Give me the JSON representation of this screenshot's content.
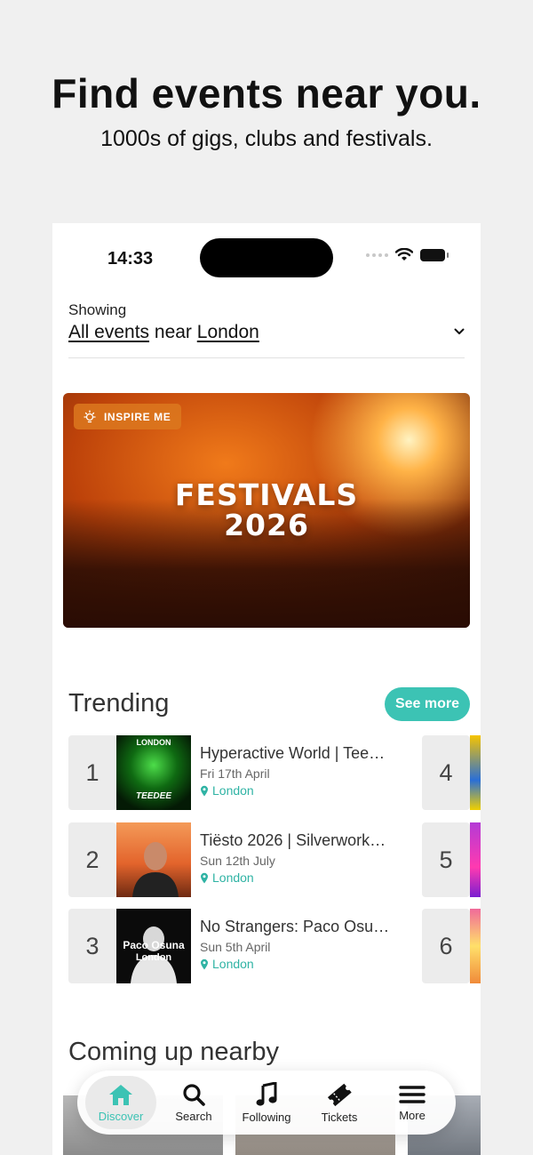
{
  "hero": {
    "title": "Find events near you.",
    "subtitle": "1000s of gigs, clubs and festivals."
  },
  "status_bar": {
    "time": "14:33"
  },
  "location_picker": {
    "showing_label": "Showing",
    "filter": "All events",
    "connector": "near",
    "city": "London"
  },
  "banner": {
    "badge": "INSPIRE ME",
    "title_line1": "FESTIVALS",
    "title_line2": "2026"
  },
  "trending": {
    "title": "Trending",
    "see_more": "See more",
    "items": [
      {
        "rank": "1",
        "title": "Hyperactive World | Tee…",
        "date": "Fri 17th April",
        "city": "London",
        "thumb_top": "LONDON",
        "thumb_bottom": "TEEDEE"
      },
      {
        "rank": "2",
        "title": "Tiësto 2026 | Silverwork…",
        "date": "Sun 12th July",
        "city": "London"
      },
      {
        "rank": "3",
        "title": "No Strangers: Paco Osu…",
        "date": "Sun 5th April",
        "city": "London",
        "thumb_top": "Paco Osuna",
        "thumb_bottom": "London"
      }
    ],
    "side_ranks": [
      "4",
      "5",
      "6"
    ]
  },
  "coming_up": {
    "title": "Coming up nearby"
  },
  "tabbar": {
    "tabs": [
      {
        "label": "Discover",
        "icon": "home-icon"
      },
      {
        "label": "Search",
        "icon": "search-icon"
      },
      {
        "label": "Following",
        "icon": "music-note-icon"
      },
      {
        "label": "Tickets",
        "icon": "ticket-icon"
      },
      {
        "label": "More",
        "icon": "menu-icon"
      }
    ]
  },
  "colors": {
    "accent": "#3cc3b4",
    "banner_orange": "#f07a1a"
  }
}
